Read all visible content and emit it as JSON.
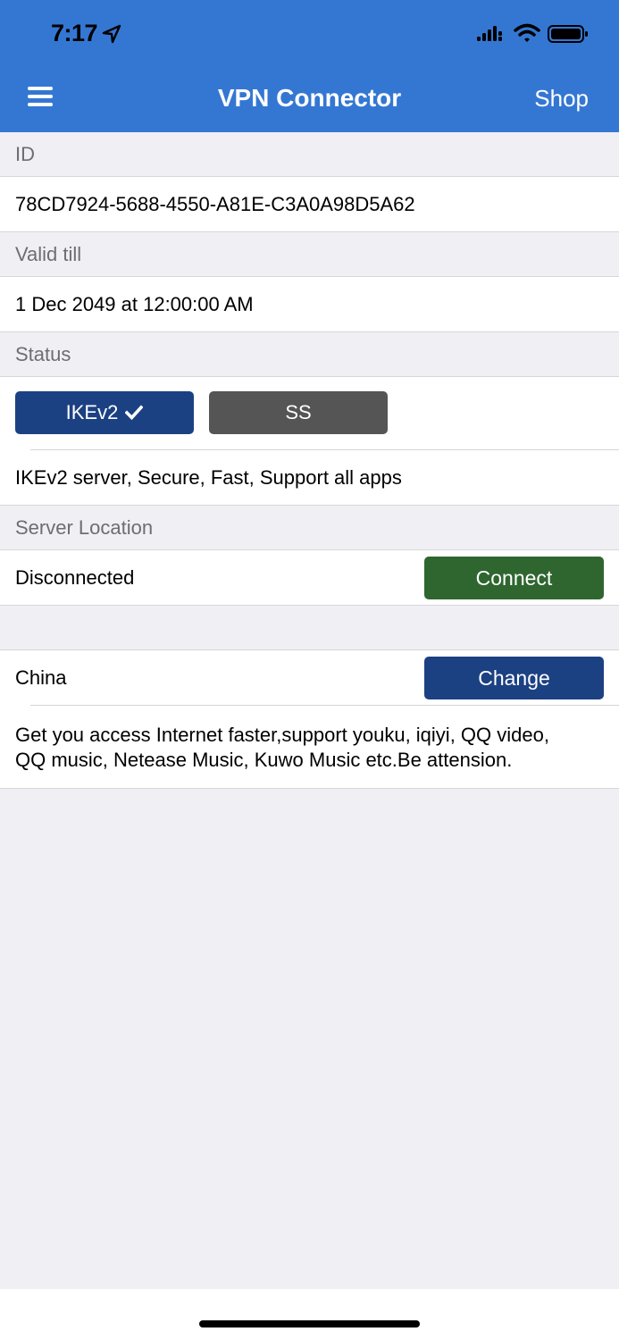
{
  "status_bar": {
    "time": "7:17",
    "icons": [
      "location-arrow-icon",
      "signal-icon",
      "wifi-icon",
      "battery-icon"
    ]
  },
  "nav": {
    "title": "VPN Connector",
    "shop_label": "Shop",
    "menu_icon": "hamburger-menu-icon"
  },
  "sections": {
    "id_header": "ID",
    "id_value": "78CD7924-5688-4550-A81E-C3A0A98D5A62",
    "valid_header": "Valid till",
    "valid_value": "1 Dec 2049 at 12:00:00 AM",
    "status_header": "Status",
    "protocol_ikev2_label": "IKEv2",
    "protocol_ss_label": "SS",
    "protocol_description": "IKEv2 server, Secure, Fast, Support all apps",
    "location_header": "Server Location",
    "connection_status": "Disconnected",
    "connect_label": "Connect",
    "location_value": "China",
    "change_label": "Change",
    "location_description": "Get you access Internet faster,support youku, iqiyi, QQ video, QQ music, Netease Music, Kuwo Music etc.Be attension."
  },
  "colors": {
    "nav_bg": "#3477d3",
    "primary_button": "#1c4182",
    "ss_button": "#555555",
    "connect_button": "#2f6630",
    "page_bg": "#efeff4"
  }
}
